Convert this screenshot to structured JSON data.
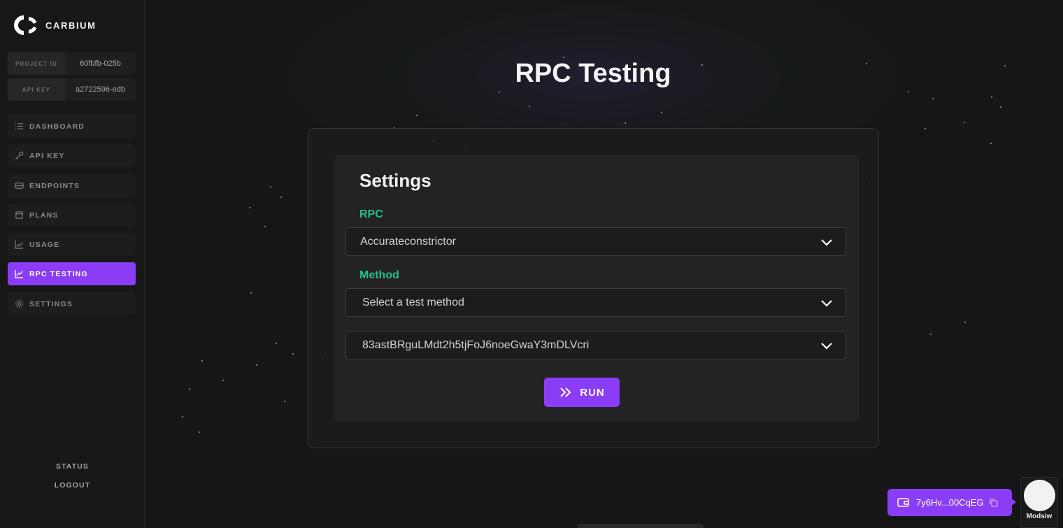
{
  "brand": {
    "name": "CARBIUM"
  },
  "credentials": {
    "project_id_label": "PROJECT ID",
    "project_id_value": "60fbfb-025b",
    "api_key_label": "API KEY",
    "api_key_value": "a2722596-edb"
  },
  "sidebar": {
    "items": [
      {
        "label": "DASHBOARD",
        "icon": "list-icon"
      },
      {
        "label": "API KEY",
        "icon": "key-icon"
      },
      {
        "label": "ENDPOINTS",
        "icon": "drive-icon"
      },
      {
        "label": "PLANS",
        "icon": "box-icon"
      },
      {
        "label": "USAGE",
        "icon": "chart-icon"
      },
      {
        "label": "RPC TESTING",
        "icon": "chart-line-icon",
        "active": true
      },
      {
        "label": "SETTINGS",
        "icon": "gear-icon"
      }
    ],
    "status_label": "STATUS",
    "logout_label": "LOGOUT"
  },
  "main": {
    "title": "RPC Testing",
    "settings_title": "Settings",
    "rpc_label": "RPC",
    "rpc_value": "Accurateconstrictor",
    "method_label": "Method",
    "method_placeholder": "Select a test method",
    "param_value": "83astBRguLMdt2h5tjFoJ6noeGwaY3mDLVcri",
    "run_label": "RUN"
  },
  "wallet": {
    "address": "7y6Hv...00CqEG"
  },
  "user": {
    "name": "Modsiw"
  },
  "colors": {
    "accent": "#8b3df5",
    "label_green": "#22c08a",
    "background": "#161616"
  }
}
